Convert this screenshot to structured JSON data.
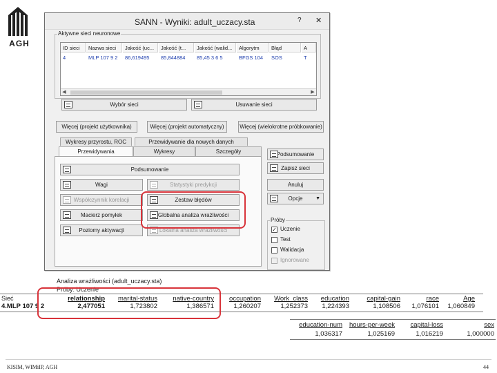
{
  "logo": {
    "text": "AGH"
  },
  "window": {
    "title": "SANN - Wyniki: adult_uczacy.sta",
    "help_label": "?",
    "close_label": "✕",
    "active_nets_label": "Aktywne sieci neuronowe",
    "net_columns": [
      "ID sieci",
      "Nazwa sieci",
      "Jakość (uc...",
      "Jakość (t...",
      "Jakość (walid...",
      "Algorytm",
      "Błąd",
      "A"
    ],
    "net_rows": [
      [
        "4",
        "MLP 107 9 2",
        "86,619495",
        "85,844884",
        "85,45 3 6 5",
        "BFGS 104",
        "SOS",
        "T"
      ]
    ],
    "select_nets_button": "Wybór sieci",
    "delete_nets_button": "Usuwanie sieci",
    "more_user_button": "Więcej (projekt użytkownika)",
    "more_auto_button": "Więcej (projekt automatyczny)",
    "more_multi_button": "Więcej (wielokrotne próbkowanie)",
    "upper_tabs": [
      "Wykresy przyrostu, ROC",
      "Przewidywanie dla nowych danych"
    ],
    "lower_tabs": [
      "Przewidywania",
      "Wykresy",
      "Szczegóły"
    ],
    "panel_buttons": {
      "summary": "Podsumowanie",
      "weights": "Wagi",
      "pred_stats": "Statystyki predykcji",
      "corr_coef": "Współczynnik korelacji",
      "conf_matrix": "Macierz pomyłek",
      "error_matrix": "Zestaw błędów",
      "activation": "Poziomy aktywacji",
      "sensitivity": "Globalna analiza wrażliwości",
      "local_sens": "Lokalna analiza wrażliwości"
    },
    "right_buttons": {
      "summary": "Podsumowanie",
      "save_nets": "Zapisz sieci",
      "cancel": "Anuluj",
      "options": "Opcje"
    },
    "samples_label": "Próby",
    "samples": [
      {
        "label": "Uczenie",
        "checked": true,
        "disabled": false
      },
      {
        "label": "Test",
        "checked": false,
        "disabled": false
      },
      {
        "label": "Walidacja",
        "checked": false,
        "disabled": false
      },
      {
        "label": "Ignorowane",
        "checked": false,
        "disabled": true
      }
    ]
  },
  "sensitivity": {
    "title": "Analiza wrażliwości (adult_uczacy.sta)",
    "subtitle": "Próby: Uczenie",
    "net_header": "Sieć",
    "net_name": "4.MLP 107 9 2",
    "row1_headers": [
      "relationship",
      "marital-status",
      "native-country",
      "occupation",
      "Work_class",
      "education",
      "capital-gain",
      "race",
      "Age"
    ],
    "row1_values": [
      "2,477051",
      "1,723802",
      "1,386571",
      "1,260207",
      "1,252373",
      "1,224393",
      "1,108506",
      "1,076101",
      "1,060849"
    ],
    "row2_headers": [
      "education-num",
      "hours-per-week",
      "capital-loss",
      "sex"
    ],
    "row2_values": [
      "1,036317",
      "1,025169",
      "1,016219",
      "1,000000"
    ]
  },
  "footer": {
    "left": "KISIM, WIMiIP, AGH",
    "page": "44"
  },
  "colors": {
    "highlight": "#d8333a",
    "grid_text": "#1f3fae"
  }
}
